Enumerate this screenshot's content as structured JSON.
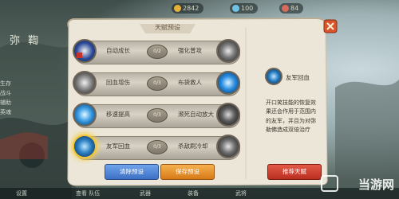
{
  "topbar": {
    "currency_1": "2842",
    "currency_2": "100",
    "currency_3": "84"
  },
  "left_title": "弥 鞫",
  "left_side": [
    "生存",
    "战斗",
    "辅助",
    "英魂"
  ],
  "bottom_strip": [
    "设置",
    "查看 队伍",
    "武器",
    "装备",
    "武将"
  ],
  "panel": {
    "title": "天赋预设",
    "rows": [
      {
        "left_name": "自动成长",
        "level": "0/2",
        "right_name": "强化普攻",
        "left_icon": "red-emblem-icon",
        "right_icon": "fist-orb-icon"
      },
      {
        "left_name": "回血增伤",
        "level": "0/3",
        "right_name": "布袋救人",
        "left_icon": "fist-orb-icon",
        "right_icon": "blue-orb-icon"
      },
      {
        "left_name": "移速提高",
        "level": "0/3",
        "right_name": "濒死自动放大",
        "left_icon": "blue-orb-icon",
        "right_icon": "spiked-orb-icon"
      },
      {
        "left_name": "友军回血",
        "level": "0/3",
        "right_name": "杀敌刷冷却",
        "left_icon": "glowing-orb-icon",
        "right_icon": "swirl-orb-icon"
      }
    ],
    "detail": {
      "name": "友军回血",
      "description": "开口笑技能的恢复效果还会作用于范围内的友军，并且为对弥勒佛造成双倍治疗"
    },
    "buttons": {
      "clear": "清除预设",
      "save": "保存预设",
      "recommend": "推荐天赋"
    }
  },
  "watermark": "当游网",
  "colors": {
    "clear_button": "#4a7fd6",
    "save_button": "#e8921f",
    "recommend_button": "#cc3f2e",
    "panel_paper": "#ece6d8"
  }
}
